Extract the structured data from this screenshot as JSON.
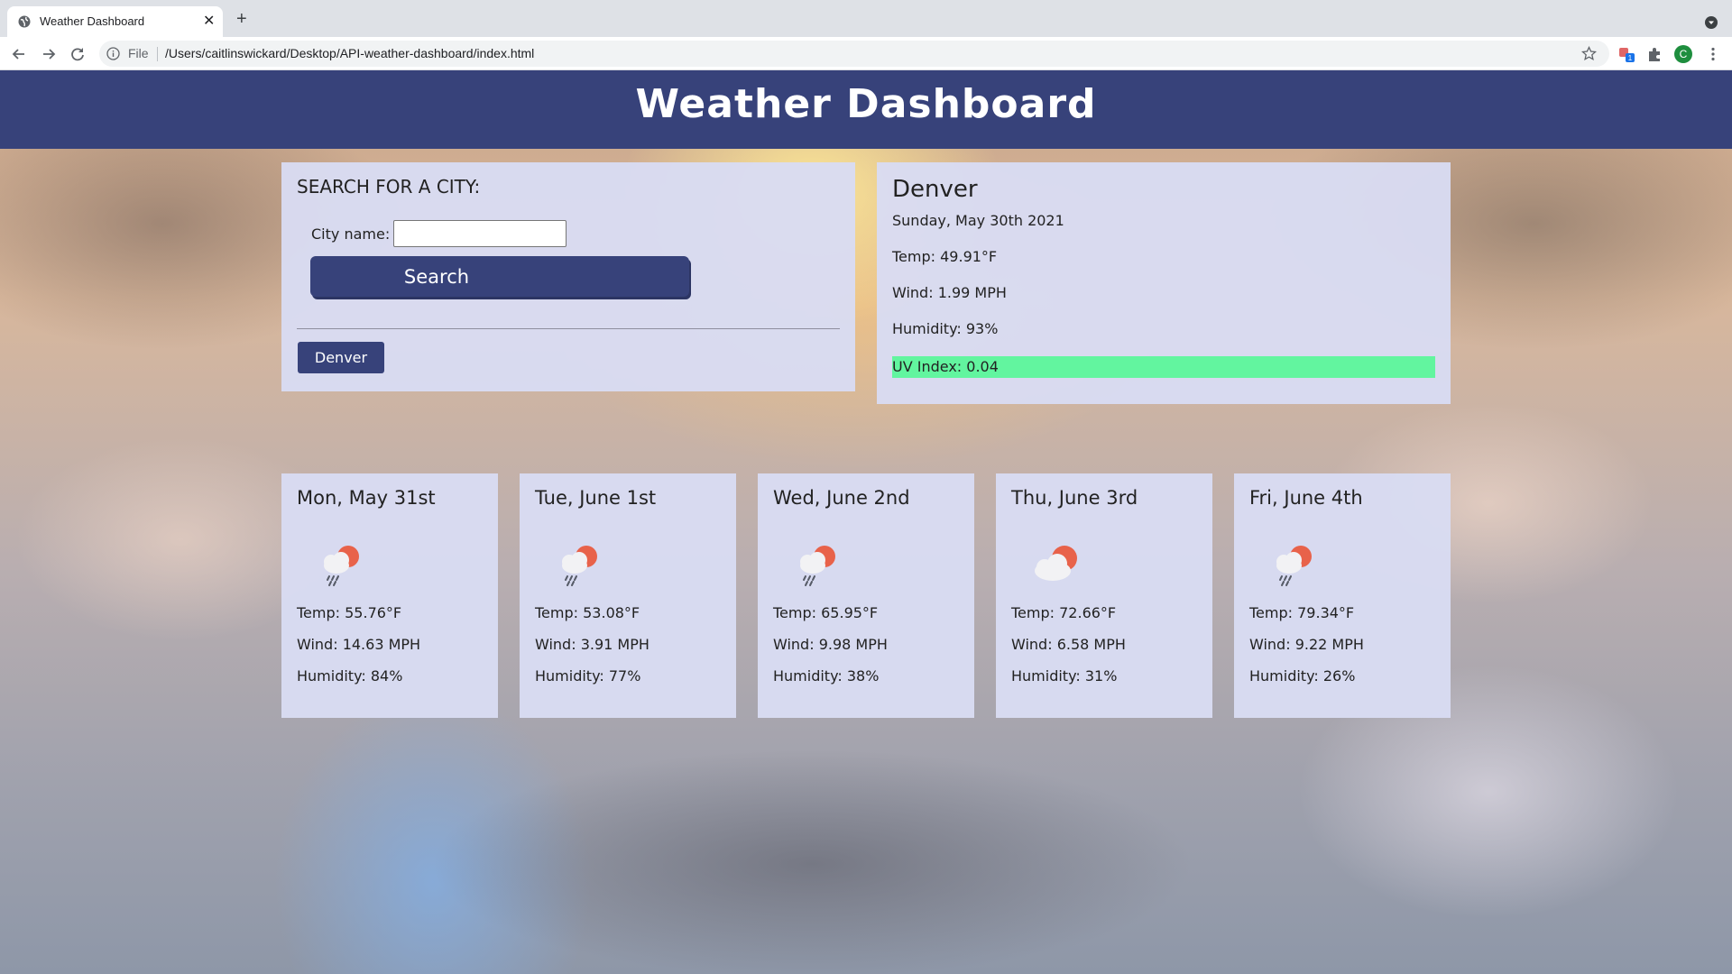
{
  "browser": {
    "tab_title": "Weather Dashboard",
    "omnibox_scheme": "File",
    "url": "/Users/caitlinswickard/Desktop/API-weather-dashboard/index.html",
    "profile_initial": "C"
  },
  "header": {
    "title": "Weather Dashboard"
  },
  "search": {
    "heading": "SEARCH FOR A CITY:",
    "city_label": "City name:",
    "city_value": "",
    "button_label": "Search",
    "history": [
      "Denver"
    ]
  },
  "current": {
    "city": "Denver",
    "date": "Sunday, May 30th 2021",
    "temp": "Temp: 49.91°F",
    "wind": "Wind: 1.99 MPH",
    "humidity": "Humidity: 93%",
    "uv": "UV Index: 0.04",
    "uv_color": "#62f59f"
  },
  "forecast": [
    {
      "date": "Mon, May 31st",
      "icon": "rain-sun-icon",
      "temp": "Temp: 55.76°F",
      "wind": "Wind: 14.63 MPH",
      "humidity": "Humidity: 84%"
    },
    {
      "date": "Tue, June 1st",
      "icon": "rain-sun-icon",
      "temp": "Temp: 53.08°F",
      "wind": "Wind: 3.91 MPH",
      "humidity": "Humidity: 77%"
    },
    {
      "date": "Wed, June 2nd",
      "icon": "rain-sun-icon",
      "temp": "Temp: 65.95°F",
      "wind": "Wind: 9.98 MPH",
      "humidity": "Humidity: 38%"
    },
    {
      "date": "Thu, June 3rd",
      "icon": "cloud-sun-icon",
      "temp": "Temp: 72.66°F",
      "wind": "Wind: 6.58 MPH",
      "humidity": "Humidity: 31%"
    },
    {
      "date": "Fri, June 4th",
      "icon": "rain-sun-icon",
      "temp": "Temp: 79.34°F",
      "wind": "Wind: 9.22 MPH",
      "humidity": "Humidity: 26%"
    }
  ],
  "colors": {
    "header_bg": "#37427a",
    "panel_bg": "#d8dcf2",
    "button_bg": "#37427a",
    "sun": "#e8624a"
  }
}
